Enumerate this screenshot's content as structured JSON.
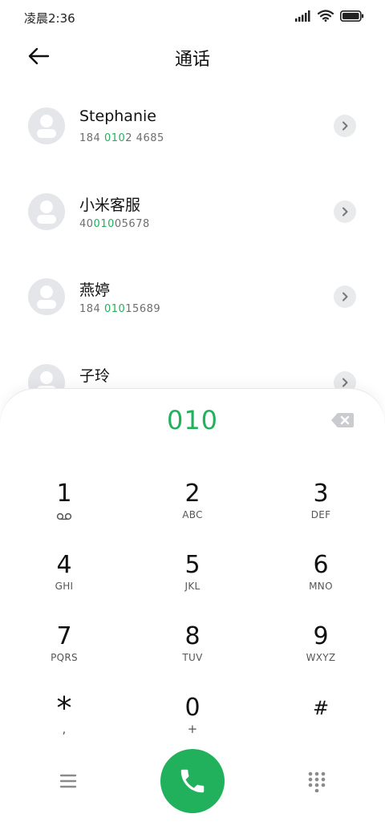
{
  "status_bar": {
    "time": "凌晨2:36",
    "icons": [
      "signal-icon",
      "wifi-icon",
      "battery-icon"
    ]
  },
  "header": {
    "title": "通话",
    "back_icon": "arrow-left-icon"
  },
  "contacts": [
    {
      "name": "Stephanie",
      "number_pre": "184 ",
      "number_hl": "010",
      "number_post": "2 4685"
    },
    {
      "name": "小米客服",
      "number_pre": "40",
      "number_hl": "010",
      "number_post": "05678"
    },
    {
      "name": "燕婷",
      "number_pre": "184 ",
      "number_hl": "010",
      "number_post": "15689"
    },
    {
      "name": "子玲",
      "number_pre": "",
      "number_hl": "",
      "number_post": ""
    }
  ],
  "dialer": {
    "dialed_number": "010",
    "keys": [
      {
        "digit": "1",
        "letters": ""
      },
      {
        "digit": "2",
        "letters": "ABC"
      },
      {
        "digit": "3",
        "letters": "DEF"
      },
      {
        "digit": "4",
        "letters": "GHI"
      },
      {
        "digit": "5",
        "letters": "JKL"
      },
      {
        "digit": "6",
        "letters": "MNO"
      },
      {
        "digit": "7",
        "letters": "PQRS"
      },
      {
        "digit": "8",
        "letters": "TUV"
      },
      {
        "digit": "9",
        "letters": "WXYZ"
      },
      {
        "digit": "*",
        "letters": ","
      },
      {
        "digit": "0",
        "letters": "+"
      },
      {
        "digit": "#",
        "letters": ""
      }
    ]
  },
  "colors": {
    "accent_green": "#21b15c",
    "avatar_bg": "#e4e6ea",
    "muted_text": "#6e6e6e"
  }
}
